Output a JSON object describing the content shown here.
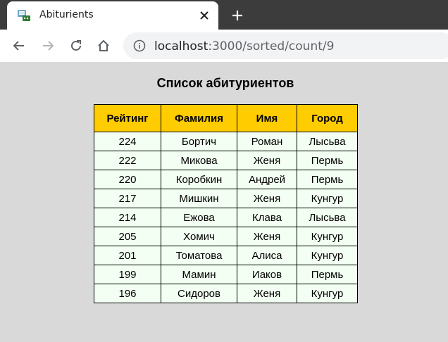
{
  "browser": {
    "tab": {
      "title": "Abiturients",
      "favicon": "server-app-icon",
      "close_icon": "close-icon"
    },
    "new_tab_icon": "plus-icon",
    "nav": {
      "back_icon": "back-arrow-icon",
      "forward_icon": "forward-arrow-icon",
      "reload_icon": "reload-icon",
      "home_icon": "home-icon"
    },
    "address": {
      "host": "localhost",
      "path": ":3000/sorted/count/9",
      "info_icon": "info-icon"
    }
  },
  "page": {
    "title": "Список абитуриентов",
    "table": {
      "columns": [
        "Рейтинг",
        "Фамилия",
        "Имя",
        "Город"
      ],
      "rows": [
        [
          "224",
          "Бортич",
          "Роман",
          "Лысьва"
        ],
        [
          "222",
          "Микова",
          "Женя",
          "Пермь"
        ],
        [
          "220",
          "Коробкин",
          "Андрей",
          "Пермь"
        ],
        [
          "217",
          "Мишкин",
          "Женя",
          "Кунгур"
        ],
        [
          "214",
          "Ежова",
          "Клава",
          "Лысьва"
        ],
        [
          "205",
          "Хомич",
          "Женя",
          "Кунгур"
        ],
        [
          "201",
          "Томатова",
          "Алиса",
          "Кунгур"
        ],
        [
          "199",
          "Мамин",
          "Иаков",
          "Пермь"
        ],
        [
          "196",
          "Сидоров",
          "Женя",
          "Кунгур"
        ]
      ]
    }
  },
  "colors": {
    "header_bg": "#ffcc00",
    "row_bg": "#f2fff2",
    "page_bg": "#d9d9d9",
    "tabstrip_bg": "#3c3c3c"
  }
}
